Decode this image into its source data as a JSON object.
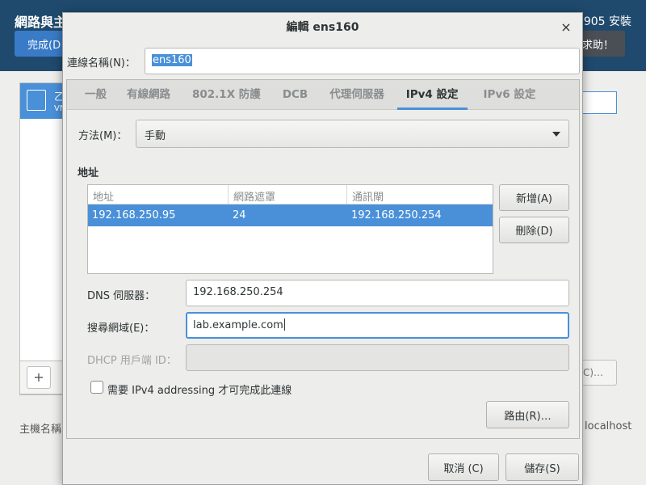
{
  "background": {
    "title": "網路與主",
    "done_button": "完成(D",
    "product": "905 安裝",
    "help_button": "求助！",
    "list_item_title": "乙",
    "list_item_sub": "VN",
    "add_button": "+",
    "configure_button": "C)…",
    "hostname_label": "主機名稱",
    "hostname_value": "localhost"
  },
  "dialog": {
    "title": "編輯 ens160",
    "close": "×",
    "connection_name_label": "連線名稱(N)：",
    "connection_name_value": "ens160",
    "tabs": [
      "一般",
      "有線網路",
      "802.1X 防護",
      "DCB",
      "代理伺服器",
      "IPv4 設定",
      "IPv6 設定"
    ],
    "active_tab": "IPv4 設定",
    "method_label": "方法(M)：",
    "method_value": "手動",
    "addresses_heading": "地址",
    "address_columns": [
      "地址",
      "網路遮罩",
      "通訊閘"
    ],
    "address_rows": [
      {
        "address": "192.168.250.95",
        "netmask": "24",
        "gateway": "192.168.250.254"
      }
    ],
    "add_button": "新增(A)",
    "delete_button": "刪除(D)",
    "dns_label": "DNS 伺服器：",
    "dns_value": "192.168.250.254",
    "search_label": "搜尋網域(E)：",
    "search_value": "lab.example.com",
    "dhcp_label": "DHCP 用戶端 ID：",
    "dhcp_value": "",
    "require_ipv4_label": "需要 IPv4 addressing 才可完成此連線",
    "require_ipv4_checked": false,
    "routes_button": "路由(R)…",
    "cancel_button": "取消 (C)",
    "save_button": "儲存(S)"
  }
}
